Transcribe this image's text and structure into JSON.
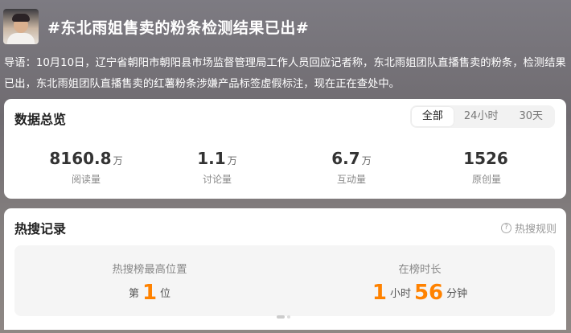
{
  "header": {
    "title": "#东北雨姐售卖的粉条检测结果已出#",
    "intro": "导语：10月10日，辽宁省朝阳市朝阳县市场监督管理局工作人员回应记者称，东北雨姐团队直播售卖的粉条，检测结果已出，东北雨姐团队直播售卖的红薯粉条涉嫌产品标签虚假标注，现在正在查处中。"
  },
  "overview": {
    "title": "数据总览",
    "tabs": [
      "全部",
      "24小时",
      "30天"
    ],
    "active_tab": "全部",
    "stats": [
      {
        "value": "8160.8",
        "unit": "万",
        "label": "阅读量"
      },
      {
        "value": "1.1",
        "unit": "万",
        "label": "讨论量"
      },
      {
        "value": "6.7",
        "unit": "万",
        "label": "互动量"
      },
      {
        "value": "1526",
        "unit": "",
        "label": "原创量"
      }
    ]
  },
  "hot": {
    "title": "热搜记录",
    "rules_label": "热搜规则",
    "rules_icon": "question-circle-icon",
    "peak": {
      "label": "热搜榜最高位置",
      "prefix": "第",
      "rank": "1",
      "suffix": "位"
    },
    "duration": {
      "label": "在榜时长",
      "hours": "1",
      "hours_unit": "小时",
      "minutes": "56",
      "minutes_unit": "分钟"
    }
  },
  "colors": {
    "accent": "#ff8200"
  }
}
